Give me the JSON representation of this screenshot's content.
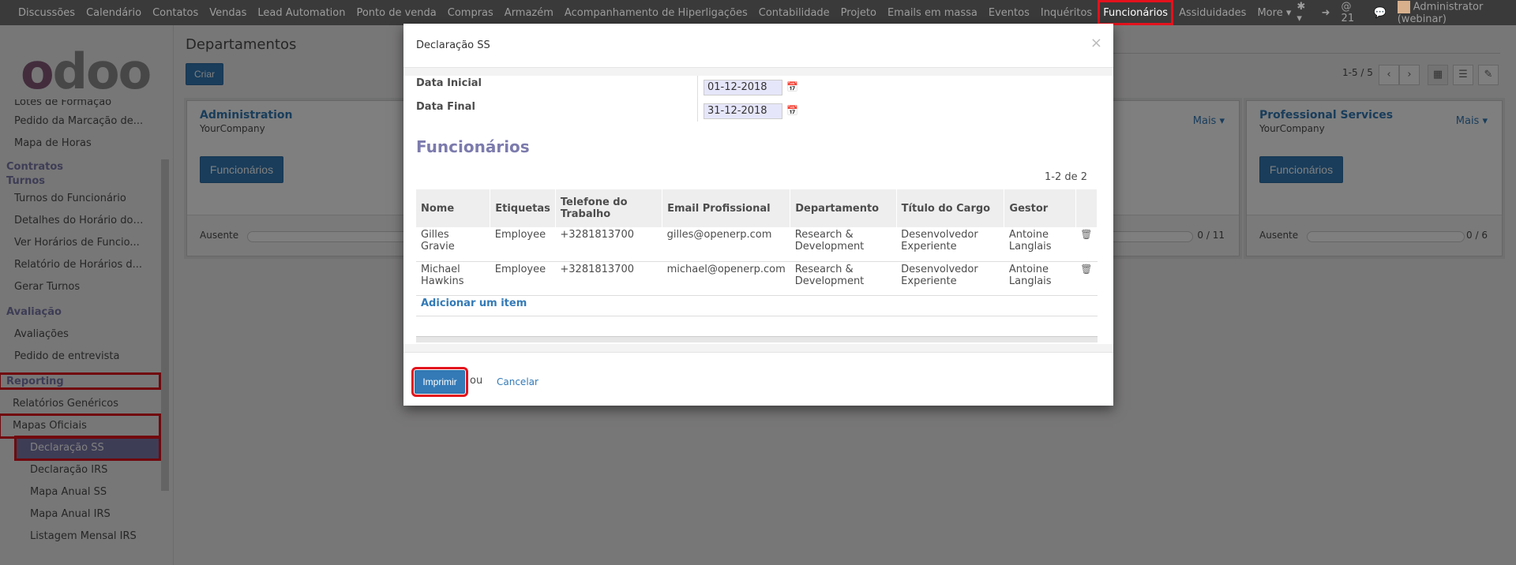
{
  "topbar": {
    "menu": [
      "Discussões",
      "Calendário",
      "Contatos",
      "Vendas",
      "Lead Automation",
      "Ponto de venda",
      "Compras",
      "Armazém",
      "Acompanhamento de Hiperligações",
      "Contabilidade",
      "Projeto",
      "Emails em massa",
      "Eventos",
      "Inquéritos",
      "Funcionários",
      "Assiduidades",
      "More ▾"
    ],
    "active_index": 14,
    "messages_count": "21",
    "user": "Administrator (webinar)"
  },
  "sidebar": {
    "logo_text": "odoo",
    "items": [
      {
        "type": "item",
        "label": "Lotes de Formação"
      },
      {
        "type": "item",
        "label": "Pedido da Marcação de..."
      },
      {
        "type": "item",
        "label": "Mapa de Horas"
      },
      {
        "type": "header",
        "label": "Contratos"
      },
      {
        "type": "header",
        "label": "Turnos"
      },
      {
        "type": "item",
        "label": "Turnos do Funcionário"
      },
      {
        "type": "item",
        "label": "Detalhes do Horário do ..."
      },
      {
        "type": "item",
        "label": "Ver Horários de Funcio..."
      },
      {
        "type": "item",
        "label": "Relatório de Horários d..."
      },
      {
        "type": "item",
        "label": "Gerar Turnos"
      },
      {
        "type": "header",
        "label": "Avaliação"
      },
      {
        "type": "item",
        "label": "Avaliações"
      },
      {
        "type": "item",
        "label": "Pedido de entrevista"
      },
      {
        "type": "header",
        "label": "Reporting"
      },
      {
        "type": "item",
        "label": "Relatórios Genéricos"
      },
      {
        "type": "item",
        "label": "Mapas Oficiais"
      },
      {
        "type": "item",
        "label": "Declaração SS"
      },
      {
        "type": "item",
        "label": "Declaração IRS"
      },
      {
        "type": "item",
        "label": "Mapa Anual SS"
      },
      {
        "type": "item",
        "label": "Mapa Anual IRS"
      },
      {
        "type": "item",
        "label": "Listagem Mensal IRS"
      }
    ]
  },
  "main": {
    "title": "Departamentos",
    "create_label": "Criar",
    "pager": "1-5 / 5",
    "cards": [
      {
        "name": "Administration",
        "company": "YourCompany",
        "button": "Funcionários",
        "footer_label": "Ausente",
        "count": ""
      },
      {
        "name": "",
        "company": "",
        "button": "",
        "footer_label": "",
        "count": "0 / 11",
        "more": "Mais ▾"
      },
      {
        "name": "Professional Services",
        "company": "YourCompany",
        "button": "Funcionários",
        "footer_label": "Ausente",
        "count": "0 / 6",
        "more": "Mais ▾"
      }
    ]
  },
  "modal": {
    "title": "Declaração SS",
    "close": "×",
    "date_start_label": "Data Inicial",
    "date_start": "01-12-2018",
    "date_end_label": "Data Final",
    "date_end": "31-12-2018",
    "section_title": "Funcionários",
    "count": "1-2 de 2",
    "columns": [
      "Nome",
      "Etiquetas",
      "Telefone do Trabalho",
      "Email Profissional",
      "Departamento",
      "Título do Cargo",
      "Gestor"
    ],
    "rows": [
      [
        "Gilles Gravie",
        "Employee",
        "+3281813700",
        "gilles@openerp.com",
        "Research & Development",
        "Desenvolvedor Experiente",
        "Antoine Langlais"
      ],
      [
        "Michael Hawkins",
        "Employee",
        "+3281813700",
        "michael@openerp.com",
        "Research & Development",
        "Desenvolvedor Experiente",
        "Antoine Langlais"
      ]
    ],
    "add_item": "Adicionar um item",
    "print_label": "Imprimir",
    "or_label": "ou",
    "cancel_label": "Cancelar"
  }
}
